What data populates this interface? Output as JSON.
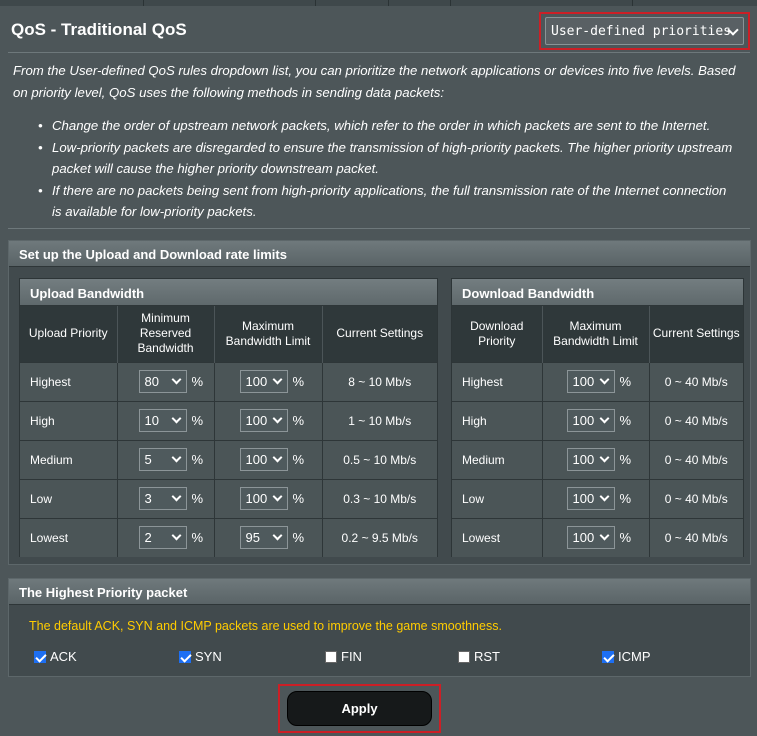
{
  "header": {
    "title": "QoS - Traditional QoS",
    "mode_select": "User-defined priorities"
  },
  "description": {
    "intro": "From the User-defined QoS rules dropdown list, you can prioritize the network applications or devices into five levels. Based on priority level, QoS uses the following methods in sending data packets:",
    "bullets": [
      "Change the order of upstream network packets, which refer to the order in which packets are sent to the Internet.",
      "Low-priority packets are disregarded to ensure the transmission of high-priority packets. The higher priority upstream packet will cause the higher priority downstream packet.",
      "If there are no packets being sent from high-priority applications, the full transmission rate of the Internet connection is available for low-priority packets."
    ]
  },
  "rate_limits": {
    "title": "Set up the Upload and Download rate limits",
    "upload": {
      "title": "Upload Bandwidth",
      "columns": [
        "Upload Priority",
        "Minimum Reserved Bandwidth",
        "Maximum Bandwidth Limit",
        "Current Settings"
      ],
      "rows": [
        {
          "priority": "Highest",
          "min": "80",
          "max": "100",
          "current": "8 ~ 10 Mb/s"
        },
        {
          "priority": "High",
          "min": "10",
          "max": "100",
          "current": "1 ~ 10 Mb/s"
        },
        {
          "priority": "Medium",
          "min": "5",
          "max": "100",
          "current": "0.5 ~ 10 Mb/s"
        },
        {
          "priority": "Low",
          "min": "3",
          "max": "100",
          "current": "0.3 ~ 10 Mb/s"
        },
        {
          "priority": "Lowest",
          "min": "2",
          "max": "95",
          "current": "0.2 ~ 9.5 Mb/s"
        }
      ]
    },
    "download": {
      "title": "Download Bandwidth",
      "columns": [
        "Download Priority",
        "Maximum Bandwidth Limit",
        "Current Settings"
      ],
      "rows": [
        {
          "priority": "Highest",
          "max": "100",
          "current": "0 ~ 40 Mb/s"
        },
        {
          "priority": "High",
          "max": "100",
          "current": "0 ~ 40 Mb/s"
        },
        {
          "priority": "Medium",
          "max": "100",
          "current": "0 ~ 40 Mb/s"
        },
        {
          "priority": "Low",
          "max": "100",
          "current": "0 ~ 40 Mb/s"
        },
        {
          "priority": "Lowest",
          "max": "100",
          "current": "0 ~ 40 Mb/s"
        }
      ]
    },
    "percent_symbol": "%"
  },
  "highest_priority": {
    "title": "The Highest Priority packet",
    "note": "The default ACK, SYN and ICMP packets are used to improve the game smoothness.",
    "packets": [
      {
        "label": "ACK",
        "checked": true
      },
      {
        "label": "SYN",
        "checked": true
      },
      {
        "label": "FIN",
        "checked": false
      },
      {
        "label": "RST",
        "checked": false
      },
      {
        "label": "ICMP",
        "checked": true
      }
    ]
  },
  "apply_label": "Apply",
  "colors": {
    "background": "#4d5659",
    "highlight_border": "#cc1f26",
    "note_text": "#ffcc00",
    "checkbox_checked": "#1d6ff3"
  }
}
